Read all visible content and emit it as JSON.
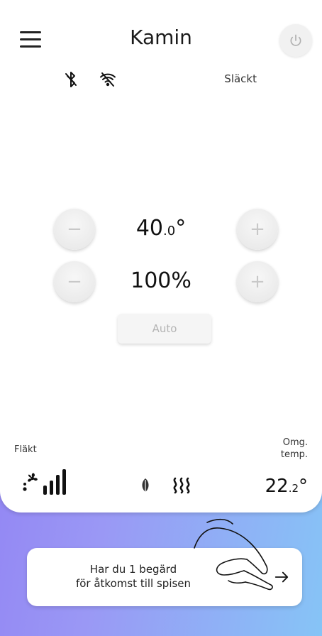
{
  "header": {
    "title": "Kamin",
    "menu_icon": "hamburger-icon",
    "power_icon": "power-icon"
  },
  "status": {
    "bluetooth_icon": "bluetooth-off-icon",
    "wifi_icon": "wifi-off-icon",
    "state": "Släckt"
  },
  "controls": {
    "temperature": {
      "main": "40",
      "decimal": ".0",
      "unit": "°"
    },
    "power": "100%",
    "auto_label": "Auto",
    "minus_glyph": "−",
    "plus_glyph": "+"
  },
  "bottom": {
    "fan_label": "Fläkt",
    "fan_icon": "fan-icon",
    "fan_level_icon": "signal-bars-icon",
    "eco_icon": "leaf-icon",
    "heat_icon": "heat-icon",
    "ambient_label_line1": "Omg.",
    "ambient_label_line2": "temp.",
    "ambient_temp": {
      "main": "22",
      "decimal": ".2",
      "unit": "°"
    }
  },
  "request": {
    "line1": "Har du 1 begärd",
    "line2": "för åtkomst till spisen",
    "arrow_icon": "arrow-right-icon"
  },
  "colors": {
    "background_start": "#8f7cf3",
    "background_end": "#86c4f6",
    "card": "#ffffff",
    "disabled": "#c8c8c8"
  }
}
